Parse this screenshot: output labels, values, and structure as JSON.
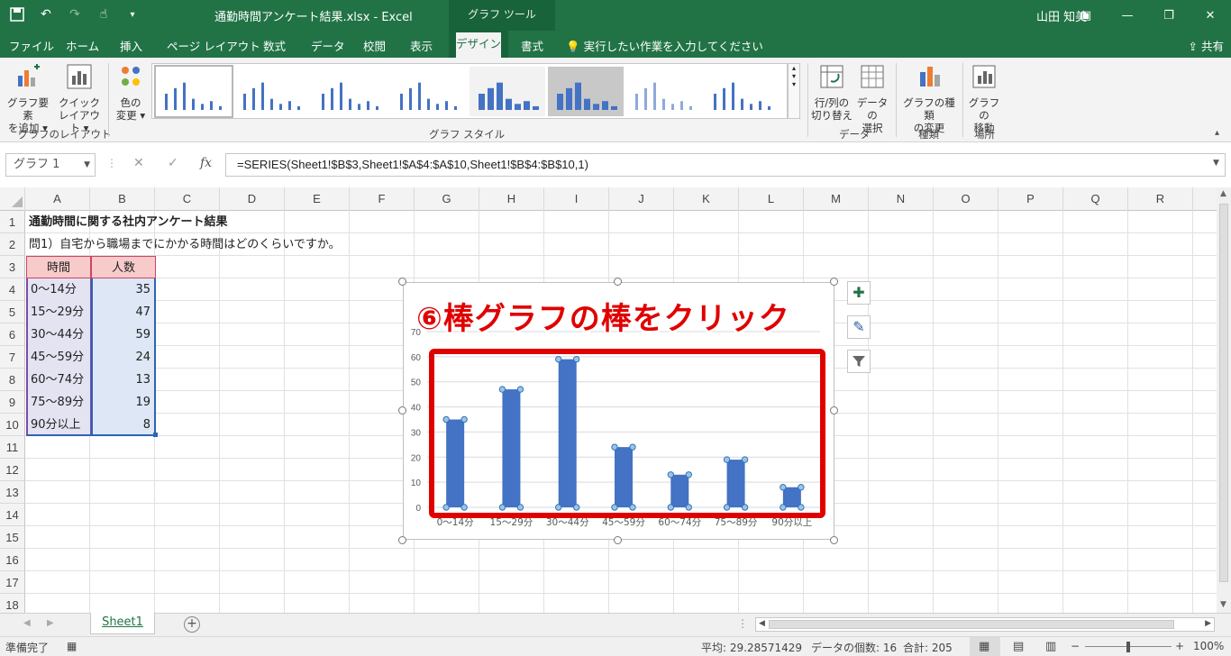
{
  "title_bar": {
    "document_title": "通勤時間アンケート結果.xlsx  -  Excel",
    "contextual_tools": "グラフ ツール",
    "user": "山田 知美"
  },
  "tabs": [
    "ファイル",
    "ホーム",
    "挿入",
    "ページ レイアウト",
    "数式",
    "データ",
    "校閲",
    "表示",
    "デザイン",
    "書式"
  ],
  "active_tab": "デザイン",
  "tell_me": "実行したい作業を入力してください",
  "share": "共有",
  "ribbon": {
    "add_element": [
      "グラフ要素",
      "を追加"
    ],
    "quick_layout": [
      "クイック",
      "レイアウト"
    ],
    "change_colors": [
      "色の",
      "変更"
    ],
    "group_layout": "グラフのレイアウト",
    "group_styles": "グラフ スタイル",
    "switch_row_col": [
      "行/列の",
      "切り替え"
    ],
    "select_data": [
      "データの",
      "選択"
    ],
    "group_data": "データ",
    "change_type": [
      "グラフの種類",
      "の変更"
    ],
    "group_type": "種類",
    "move_chart": [
      "グラフの",
      "移動"
    ],
    "group_location": "場所"
  },
  "formula_bar": {
    "name_box": "グラフ 1",
    "formula": "=SERIES(Sheet1!$B$3,Sheet1!$A$4:$A$10,Sheet1!$B$4:$B$10,1)"
  },
  "columns": [
    "A",
    "B",
    "C",
    "D",
    "E",
    "F",
    "G",
    "H",
    "I",
    "J",
    "K",
    "L",
    "M",
    "N",
    "O",
    "P",
    "Q",
    "R"
  ],
  "rows": [
    "1",
    "2",
    "3",
    "4",
    "5",
    "6",
    "7",
    "8",
    "9",
    "10",
    "11",
    "12",
    "13",
    "14",
    "15",
    "16",
    "17",
    "18"
  ],
  "sheet": {
    "a1": "通勤時間に関する社内アンケート結果",
    "a2": "問1）自宅から職場までにかかる時間はどのくらいですか。",
    "header_time": "時間",
    "header_count": "人数",
    "table": [
      {
        "time": "0～14分",
        "count": "35"
      },
      {
        "time": "15～29分",
        "count": "47"
      },
      {
        "time": "30～44分",
        "count": "59"
      },
      {
        "time": "45～59分",
        "count": "24"
      },
      {
        "time": "60～74分",
        "count": "13"
      },
      {
        "time": "75～89分",
        "count": "19"
      },
      {
        "time": "90分以上",
        "count": "8"
      }
    ]
  },
  "annotation": "⑥棒グラフの棒をクリック",
  "chart_data": {
    "type": "bar",
    "categories": [
      "0～14分",
      "15～29分",
      "30～44分",
      "45～59分",
      "60～74分",
      "75～89分",
      "90分以上"
    ],
    "values": [
      35,
      47,
      59,
      24,
      13,
      19,
      8
    ],
    "ylim": [
      0,
      70
    ],
    "yticks": [
      0,
      10,
      20,
      30,
      40,
      50,
      60,
      70
    ],
    "grid": true,
    "bar_color": "#4472c4"
  },
  "sheet_tab": "Sheet1",
  "status": {
    "ready": "準備完了",
    "average": "平均: 29.28571429",
    "count": "データの個数: 16",
    "sum": "合計: 205",
    "zoom": "100%"
  },
  "colors": {
    "excel_green": "#217346",
    "highlight_red": "#e00000"
  }
}
